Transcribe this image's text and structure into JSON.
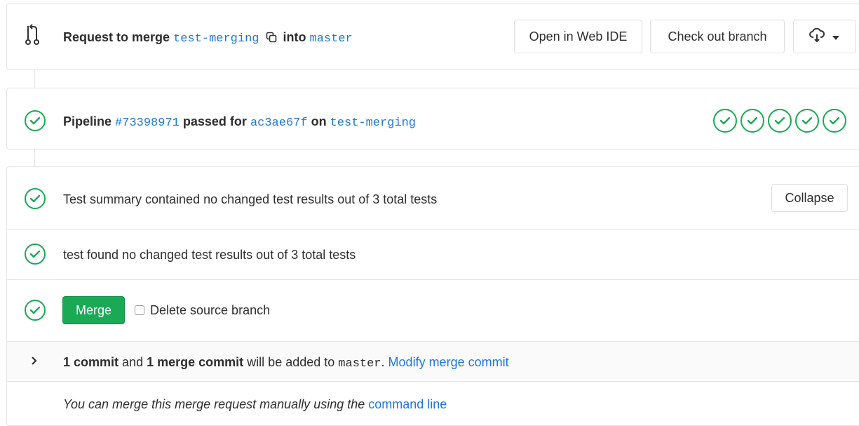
{
  "header": {
    "request_label": "Request to merge",
    "source_branch": "test-merging",
    "into_label": "into",
    "target_branch": "master",
    "open_web_ide": "Open in Web IDE",
    "check_out_branch": "Check out branch",
    "download_icon": "cloud-download-icon",
    "dropdown_icon": "caret-down-icon"
  },
  "pipeline": {
    "label": "Pipeline",
    "id": "#73398971",
    "passed_for": "passed for",
    "commit": "ac3ae67f",
    "on_label": "on",
    "branch": "test-merging",
    "stages": [
      "passed",
      "passed",
      "passed",
      "passed",
      "passed"
    ]
  },
  "tests": {
    "summary": "Test summary contained no changed test results out of 3 total tests",
    "collapse": "Collapse",
    "suite": "test found no changed test results out of 3 total tests"
  },
  "merge": {
    "button": "Merge",
    "delete_source": "Delete source branch",
    "delete_checked": false
  },
  "commits": {
    "commit_count": "1 commit",
    "and_label": "and",
    "merge_commit": "1 merge commit",
    "will_be_added": "will be added to",
    "target": "master",
    "modify": "Modify merge commit"
  },
  "manual": {
    "text": "You can merge this merge request manually using the",
    "link": "command line"
  },
  "colors": {
    "success": "#1aaa55",
    "link": "#1f78d1",
    "merge_button": "#1aaa55"
  }
}
